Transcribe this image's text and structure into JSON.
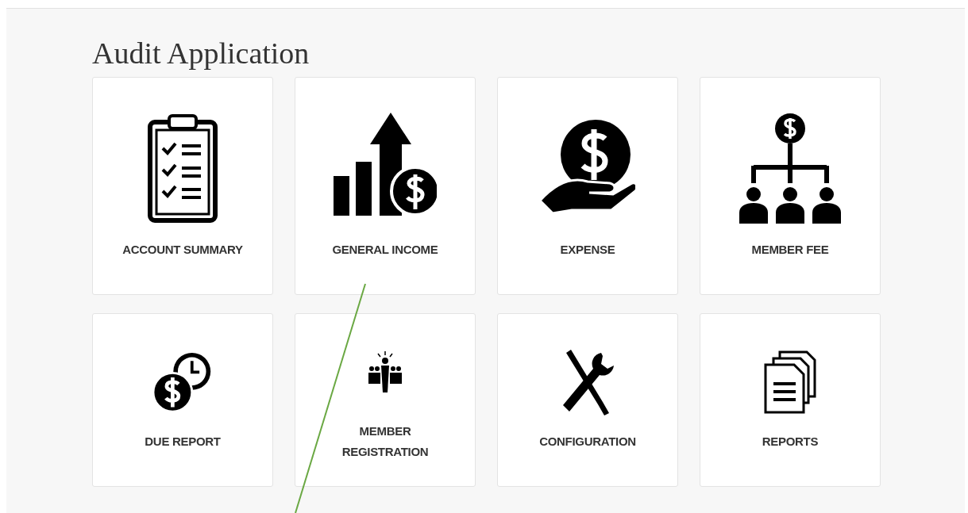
{
  "page": {
    "title": "Audit Application"
  },
  "tiles": [
    {
      "label": "ACCOUNT SUMMARY"
    },
    {
      "label": "GENERAL INCOME"
    },
    {
      "label": "EXPENSE"
    },
    {
      "label": "MEMBER FEE"
    },
    {
      "label": "DUE REPORT"
    },
    {
      "label": "MEMBER REGISTRATION"
    },
    {
      "label": "CONFIGURATION"
    },
    {
      "label": "REPORTS"
    }
  ]
}
